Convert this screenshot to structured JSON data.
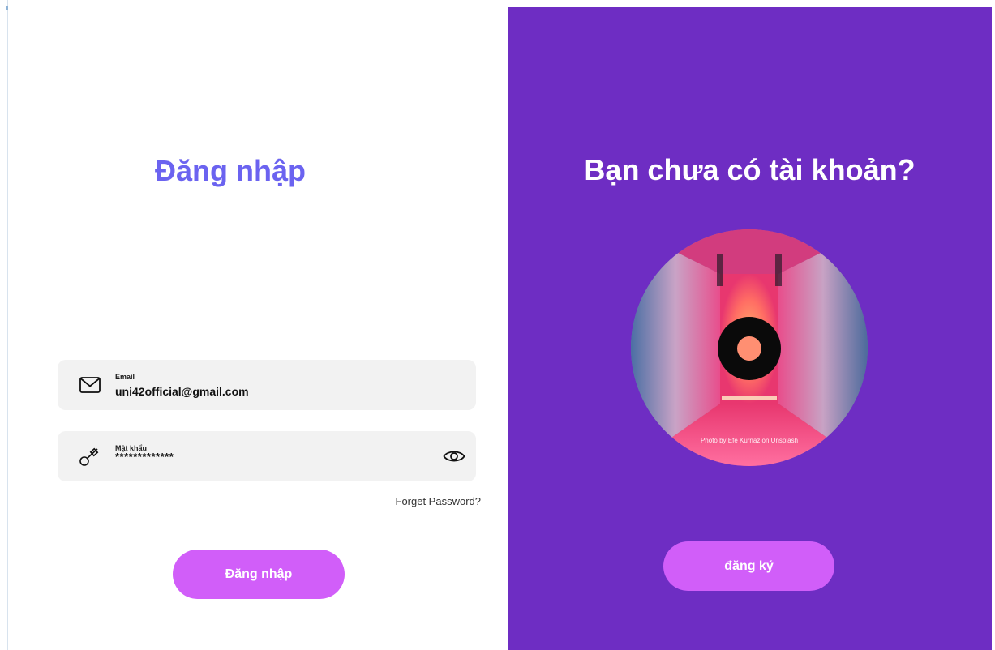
{
  "login": {
    "title": "Đăng nhập",
    "email": {
      "label": "Email",
      "value": "uni42official@gmail.com",
      "icon": "mail-icon"
    },
    "password": {
      "label": "Mật khẩu",
      "value": "*************",
      "icon": "key-icon",
      "toggle_icon": "eye-icon"
    },
    "forget_password": "Forget Password?",
    "submit_label": "Đăng nhập"
  },
  "signup": {
    "title": "Bạn chưa có tài khoản?",
    "photo_credit": "Photo by Efe Kurnaz on Unsplash",
    "button_label": "đăng ký"
  },
  "colors": {
    "accent_title": "#6b63f0",
    "panel_purple": "#6e2dc3",
    "button_pink": "#d15ef9",
    "field_bg": "#f2f2f2"
  }
}
